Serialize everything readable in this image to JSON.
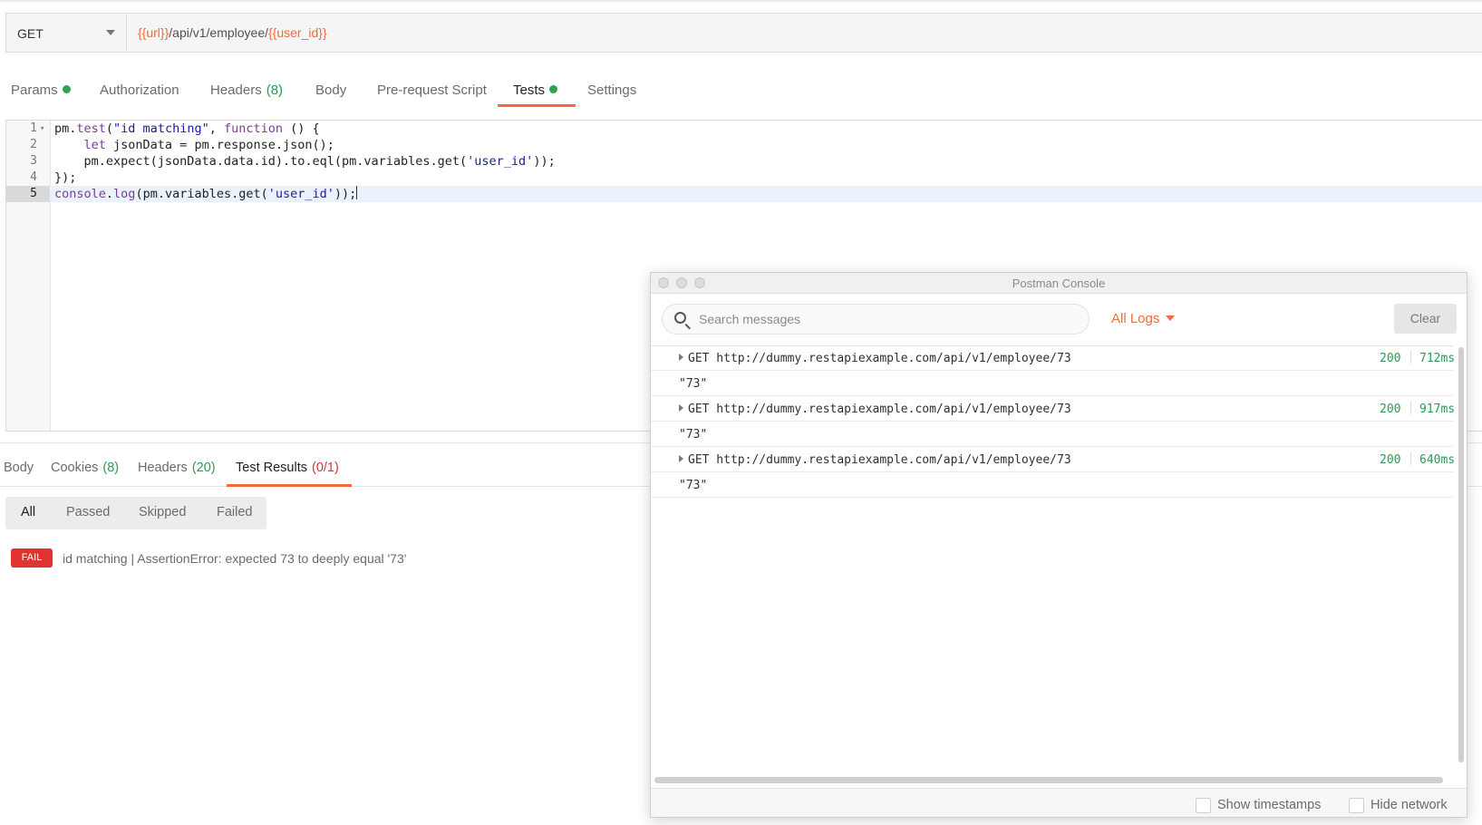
{
  "request": {
    "method": "GET",
    "url_parts": [
      {
        "text": "{{url}}",
        "variable": true
      },
      {
        "text": "/api/v1/employee/",
        "variable": false
      },
      {
        "text": "{{user_id}}",
        "variable": true
      }
    ]
  },
  "request_tabs": [
    {
      "label": "Params",
      "dot": true,
      "count": "",
      "active": false
    },
    {
      "label": "Authorization",
      "dot": false,
      "count": "",
      "active": false
    },
    {
      "label": "Headers",
      "dot": false,
      "count": "(8)",
      "active": false
    },
    {
      "label": "Body",
      "dot": false,
      "count": "",
      "active": false
    },
    {
      "label": "Pre-request Script",
      "dot": false,
      "count": "",
      "active": false
    },
    {
      "label": "Tests",
      "dot": true,
      "count": "",
      "active": true
    },
    {
      "label": "Settings",
      "dot": false,
      "count": "",
      "active": false
    }
  ],
  "editor": {
    "lines": [
      {
        "number": "1",
        "foldable": true,
        "tokens": [
          [
            "",
            "pm."
          ],
          [
            "fn",
            "test"
          ],
          [
            "",
            "("
          ],
          [
            "str",
            "\"id matching\""
          ],
          [
            "",
            ", "
          ],
          [
            "kw",
            "function"
          ],
          [
            "",
            " () {"
          ]
        ]
      },
      {
        "number": "2",
        "foldable": false,
        "tokens": [
          [
            "",
            "    "
          ],
          [
            "kw",
            "let"
          ],
          [
            "",
            " jsonData = pm.response.json();"
          ]
        ]
      },
      {
        "number": "3",
        "foldable": false,
        "tokens": [
          [
            "",
            "    pm.expect(jsonData.data.id).to.eql(pm.variables.get("
          ],
          [
            "str",
            "'user_id'"
          ],
          [
            "",
            "));"
          ]
        ]
      },
      {
        "number": "4",
        "foldable": false,
        "tokens": [
          [
            "",
            "});"
          ]
        ]
      },
      {
        "number": "5",
        "foldable": false,
        "current": true,
        "tokens": [
          [
            "fn",
            "console"
          ],
          [
            "",
            "."
          ],
          [
            "fn",
            "log"
          ],
          [
            "",
            "(pm.variables.get("
          ],
          [
            "str",
            "'user_id'"
          ],
          [
            "",
            "));"
          ]
        ]
      }
    ]
  },
  "response_tabs": [
    {
      "label": "Body",
      "count": "",
      "active": false
    },
    {
      "label": "Cookies",
      "count": "(8)",
      "active": false
    },
    {
      "label": "Headers",
      "count": "(20)",
      "active": false
    },
    {
      "label": "Test Results",
      "count": "(0/1)",
      "active": true
    }
  ],
  "result_filters": [
    "All",
    "Passed",
    "Skipped",
    "Failed"
  ],
  "test_result": {
    "badge": "FAIL",
    "message": "id matching | AssertionError: expected 73 to deeply equal '73'"
  },
  "console": {
    "title": "Postman Console",
    "search_placeholder": "Search messages",
    "filter_label": "All Logs",
    "clear_label": "Clear",
    "entries": [
      {
        "request": "GET http://dummy.restapiexample.com/api/v1/employee/73",
        "status": "200",
        "time": "712ms",
        "value": "\"73\""
      },
      {
        "request": "GET http://dummy.restapiexample.com/api/v1/employee/73",
        "status": "200",
        "time": "917ms",
        "value": "\"73\""
      },
      {
        "request": "GET http://dummy.restapiexample.com/api/v1/employee/73",
        "status": "200",
        "time": "640ms",
        "value": "\"73\""
      }
    ],
    "show_timestamps_label": "Show timestamps",
    "hide_network_label": "Hide network"
  },
  "colors": {
    "accent": "#f26b3a",
    "success": "#2a9a55",
    "fail": "#e0322e"
  }
}
